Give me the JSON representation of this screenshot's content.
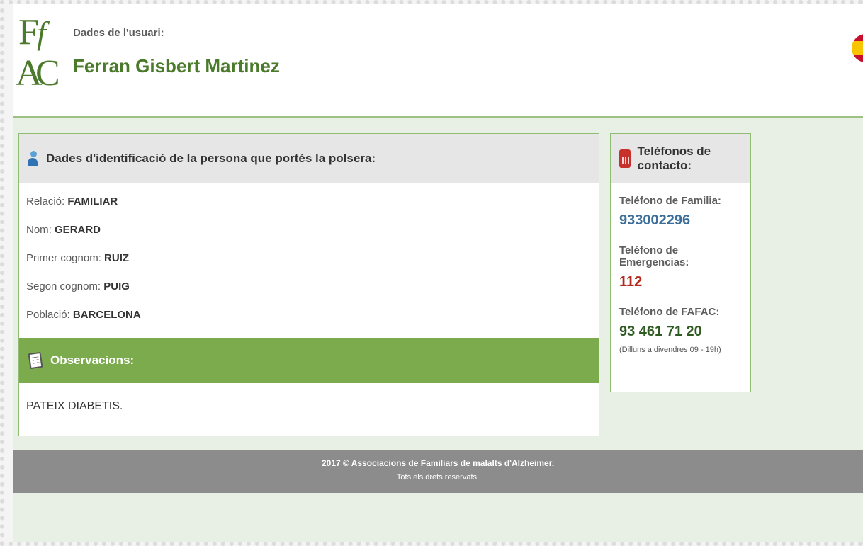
{
  "header": {
    "logo": {
      "letters": [
        "F",
        "f",
        "A",
        "C"
      ]
    },
    "user_label": "Dades de l'usuari:",
    "user_name": "Ferran Gisbert Martinez",
    "language_flag": "spain-flag-icon"
  },
  "identification": {
    "title": "Dades d'identificació de la persona que portés la polsera:",
    "icon": "person-icon",
    "fields": [
      {
        "label": "Relació: ",
        "value": "FAMILIAR"
      },
      {
        "label": "Nom: ",
        "value": "GERARD"
      },
      {
        "label": "Primer cognom: ",
        "value": "RUIZ"
      },
      {
        "label": "Segon cognom: ",
        "value": "PUIG"
      },
      {
        "label": "Població: ",
        "value": "BARCELONA"
      }
    ]
  },
  "observations": {
    "title": "Observacions:",
    "icon": "notepad-icon",
    "text": "PATEIX DIABETIS."
  },
  "contacts": {
    "title": "Teléfonos de contacto:",
    "icon": "phone-icon",
    "family_label": "Teléfono de Familia:",
    "family_value": "933002296",
    "emergency_label": "Teléfono de Emergencias:",
    "emergency_value": "112",
    "fafac_label": "Teléfono de FAFAC:",
    "fafac_value": "93 461 71 20",
    "fafac_hours": "(Dilluns a divendres 09 - 19h)"
  },
  "footer": {
    "line1": "2017 © Associacions de Familiars de malalts d'Alzheimer.",
    "line2": "Tots els drets reservats."
  },
  "colors": {
    "brand_green": "#7cab4d",
    "name_green": "#4a7a2a",
    "family_phone_blue": "#3c6e9a",
    "emergency_red": "#b22a1e",
    "fafac_green": "#2f5a22",
    "footer_gray": "#8c8c8c"
  }
}
